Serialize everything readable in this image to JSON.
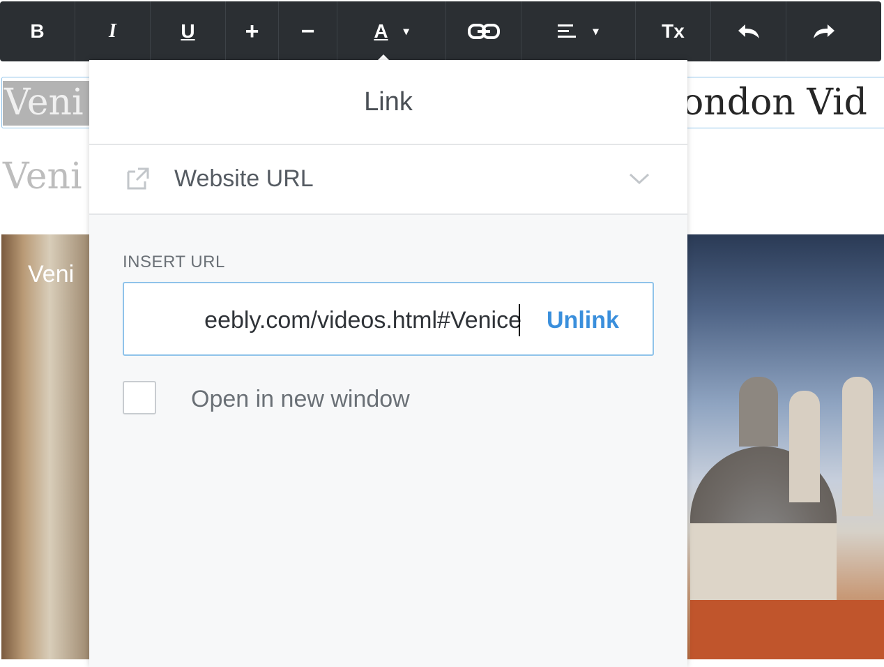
{
  "toolbar": {
    "bold": "B",
    "italic": "I",
    "underline": "U",
    "increase_size": "+",
    "decrease_size": "−",
    "text_color": "A",
    "clear_format": "Tx",
    "caret": "▾",
    "icons": [
      "bold-icon",
      "italic-icon",
      "underline-icon",
      "plus-icon",
      "minus-icon",
      "text-color-icon",
      "link-icon",
      "align-icon",
      "clear-format-icon",
      "undo-icon",
      "redo-icon"
    ]
  },
  "page": {
    "heading_left": "Veni",
    "heading_right": "ondon Vid",
    "subheading": "Veni",
    "photo_caption": "Veni"
  },
  "link_popup": {
    "title": "Link",
    "type_label": "Website URL",
    "field_label": "INSERT URL",
    "url_value": "eebly.com/videos.html#Venice",
    "unlink_label": "Unlink",
    "new_window_label": "Open in new window",
    "new_window_checked": false
  },
  "colors": {
    "toolbar_bg": "#2b2f33",
    "accent": "#3a8fdc",
    "selection": "#b3b3b3"
  }
}
